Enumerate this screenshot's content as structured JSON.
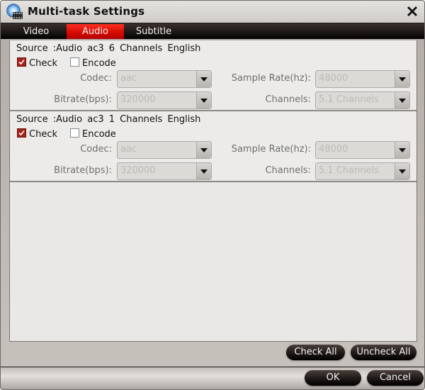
{
  "window": {
    "title": "Multi-task Settings",
    "icon": "app-disc-film-icon",
    "close_icon": "close-icon"
  },
  "tabs": [
    {
      "label": "Video",
      "active": false
    },
    {
      "label": "Audio",
      "active": true
    },
    {
      "label": "Subtitle",
      "active": false
    }
  ],
  "tracks": [
    {
      "source": "Source :Audio  ac3  6 Channels  English",
      "check": {
        "label": "Check",
        "checked": true
      },
      "encode": {
        "label": "Encode",
        "checked": false
      },
      "codec": {
        "label": "Codec:",
        "value": "aac"
      },
      "sample_rate": {
        "label": "Sample Rate(hz):",
        "value": "48000"
      },
      "bitrate": {
        "label": "Bitrate(bps):",
        "value": "320000"
      },
      "channels": {
        "label": "Channels:",
        "value": "5.1 Channels"
      }
    },
    {
      "source": "Source :Audio  ac3  1 Channels  English",
      "check": {
        "label": "Check",
        "checked": true
      },
      "encode": {
        "label": "Encode",
        "checked": false
      },
      "codec": {
        "label": "Codec:",
        "value": "aac"
      },
      "sample_rate": {
        "label": "Sample Rate(hz):",
        "value": "48000"
      },
      "bitrate": {
        "label": "Bitrate(bps):",
        "value": "320000"
      },
      "channels": {
        "label": "Channels:",
        "value": "5.1 Channels"
      }
    }
  ],
  "buttons": {
    "check_all": "Check All",
    "uncheck_all": "Uncheck All",
    "ok": "OK",
    "cancel": "Cancel"
  },
  "colors": {
    "active_tab": "#d10a00",
    "checkbox_checked": "#a8201a",
    "button_dark": "#1e1816"
  }
}
